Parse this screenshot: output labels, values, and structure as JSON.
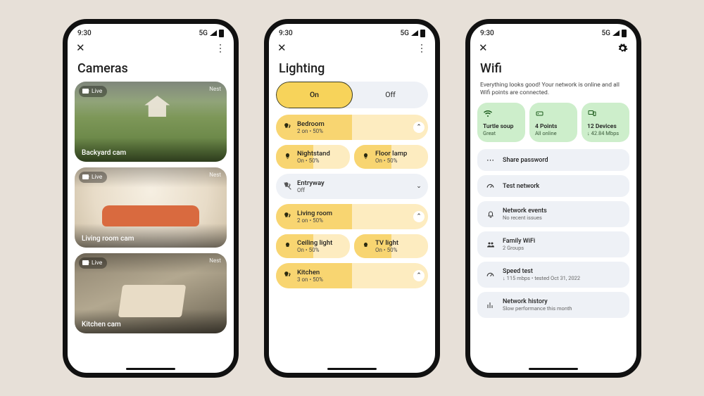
{
  "status": {
    "time": "9:30",
    "net": "5G"
  },
  "cameras": {
    "title": "Cameras",
    "items": [
      {
        "live": "Live",
        "brand": "Nest",
        "label": "Backyard cam"
      },
      {
        "live": "Live",
        "brand": "Nest",
        "label": "Living room cam"
      },
      {
        "live": "Live",
        "brand": "Nest",
        "label": "Kitchen cam"
      }
    ]
  },
  "lighting": {
    "title": "Lighting",
    "seg_on": "On",
    "seg_off": "Off",
    "rooms": [
      {
        "name": "Bedroom",
        "sub": "2 on • 50%",
        "on": true,
        "children": [
          {
            "name": "Nightstand",
            "sub": "On • 50%"
          },
          {
            "name": "Floor lamp",
            "sub": "On • 50%"
          }
        ]
      },
      {
        "name": "Entryway",
        "sub": "Off",
        "on": false
      },
      {
        "name": "Living room",
        "sub": "2 on • 50%",
        "on": true,
        "children": [
          {
            "name": "Ceiling light",
            "sub": "On • 50%"
          },
          {
            "name": "TV light",
            "sub": "On • 50%"
          }
        ]
      },
      {
        "name": "Kitchen",
        "sub": "3 on • 50%",
        "on": true
      }
    ]
  },
  "wifi": {
    "title": "Wifi",
    "subtitle": "Everything looks good! Your network is online and all Wifi points are connected.",
    "cards": [
      {
        "title": "Turtle soup",
        "sub": "Great"
      },
      {
        "title": "4 Points",
        "sub": "All online"
      },
      {
        "title": "12 Devices",
        "sub": "↓ 42.84 Mbps"
      }
    ],
    "rows": [
      {
        "title": "Share password",
        "sub": ""
      },
      {
        "title": "Test network",
        "sub": ""
      },
      {
        "title": "Network events",
        "sub": "No recent issues"
      },
      {
        "title": "Family WiFi",
        "sub": "2 Groups"
      },
      {
        "title": "Speed test",
        "sub": "↓ 115 mbps • tested Oct 31, 2022"
      },
      {
        "title": "Network history",
        "sub": "Slow performance this month"
      }
    ]
  }
}
